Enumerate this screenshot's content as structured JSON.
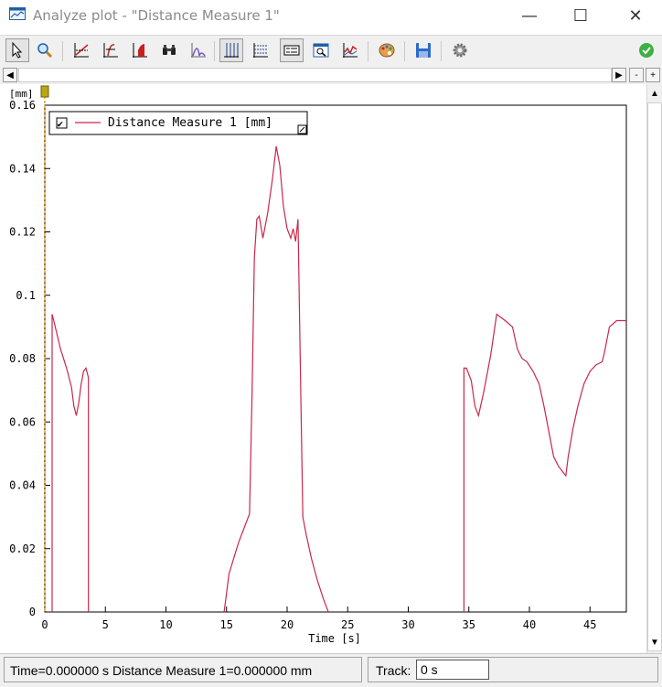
{
  "window": {
    "title": "Analyze plot - \"Distance Measure 1\"",
    "minimize_glyph": "—",
    "maximize_glyph": "☐",
    "close_glyph": "✕"
  },
  "toolbar": {
    "icons": [
      "pointer-icon",
      "magnifier-icon",
      "linear-fit-icon",
      "function-icon",
      "integral-area-icon",
      "binoculars-icon",
      "spectrum-icon",
      "vertical-grid-icon",
      "horizontal-grid-icon",
      "legend-icon",
      "zoom-window-icon",
      "chart-icon",
      "palette-icon",
      "save-icon",
      "settings-icon",
      "ok-icon"
    ]
  },
  "hscroll": {
    "left_arrow": "◀",
    "right_arrow": "▶",
    "minus": "-",
    "plus": "+"
  },
  "vscroll": {
    "up_arrow": "▲",
    "down_arrow": "▼"
  },
  "chart_data": {
    "type": "line",
    "ylabel": "[mm]",
    "xlabel": "Time [s]",
    "xlim": [
      0,
      48
    ],
    "ylim": [
      0,
      0.16
    ],
    "xticks": [
      0,
      5,
      10,
      15,
      20,
      25,
      30,
      35,
      40,
      45
    ],
    "yticks": [
      0,
      0.02,
      0.04,
      0.06,
      0.08,
      0.1,
      0.12,
      0.14,
      0.16
    ],
    "ytick_labels": [
      "0",
      "0.02",
      "0.04",
      "0.06",
      "0.08",
      "0.1",
      "0.12",
      "0.14",
      "0.16"
    ],
    "series": [
      {
        "name": "Distance Measure 1 [mm]",
        "color": "#c8284a",
        "segments": [
          {
            "x": [
              0.6,
              0.6,
              0.8,
              1.3,
              1.8,
              2.2,
              2.4,
              2.6,
              2.8,
              3.0,
              3.2,
              3.4,
              3.6,
              3.6,
              3.6
            ],
            "y": [
              0,
              0.094,
              0.091,
              0.083,
              0.077,
              0.071,
              0.065,
              0.062,
              0.066,
              0.072,
              0.076,
              0.077,
              0.074,
              0.037,
              0
            ]
          },
          {
            "x": [
              14.8,
              15.0,
              15.2,
              15.6,
              16.0,
              16.5,
              16.9,
              17.1,
              17.3,
              17.5,
              17.7,
              18.0,
              18.4,
              18.8,
              19.1,
              19.4,
              19.7,
              20.0,
              20.3,
              20.5,
              20.7,
              20.9,
              21.1,
              21.3,
              21.6,
              22.0,
              22.5,
              23.0,
              23.4
            ],
            "y": [
              0,
              0.006,
              0.012,
              0.017,
              0.022,
              0.027,
              0.031,
              0.068,
              0.112,
              0.124,
              0.125,
              0.118,
              0.126,
              0.137,
              0.147,
              0.141,
              0.128,
              0.121,
              0.118,
              0.121,
              0.117,
              0.124,
              0.075,
              0.03,
              0.024,
              0.017,
              0.01,
              0.004,
              0
            ]
          },
          {
            "x": [
              34.6,
              34.6,
              34.8,
              35.2,
              35.5,
              35.8,
              36.2,
              36.8,
              37.3,
              38.0,
              38.6,
              39.0,
              39.4,
              39.8,
              40.3,
              40.8,
              41.2,
              41.6,
              42.0,
              42.4,
              42.8,
              43.0,
              43.2,
              43.6,
              44.0,
              44.5,
              45.0,
              45.5,
              46.0,
              46.2,
              46.6,
              47.2,
              48.0
            ],
            "y": [
              0,
              0.077,
              0.077,
              0.073,
              0.065,
              0.062,
              0.069,
              0.081,
              0.094,
              0.092,
              0.09,
              0.083,
              0.08,
              0.079,
              0.076,
              0.072,
              0.065,
              0.057,
              0.049,
              0.046,
              0.044,
              0.043,
              0.049,
              0.058,
              0.065,
              0.072,
              0.076,
              0.078,
              0.079,
              0.082,
              0.09,
              0.092,
              0.092
            ]
          }
        ]
      }
    ],
    "legend": {
      "label": "Distance Measure 1 [mm]",
      "checked": true,
      "placement": "top-left",
      "check_glyph": "✔"
    },
    "cursor": {
      "x": 0
    },
    "grid": false
  },
  "status": {
    "readout": "Time=0.000000 s Distance Measure 1=0.000000 mm",
    "track_label": "Track:",
    "track_value": "0 s"
  }
}
